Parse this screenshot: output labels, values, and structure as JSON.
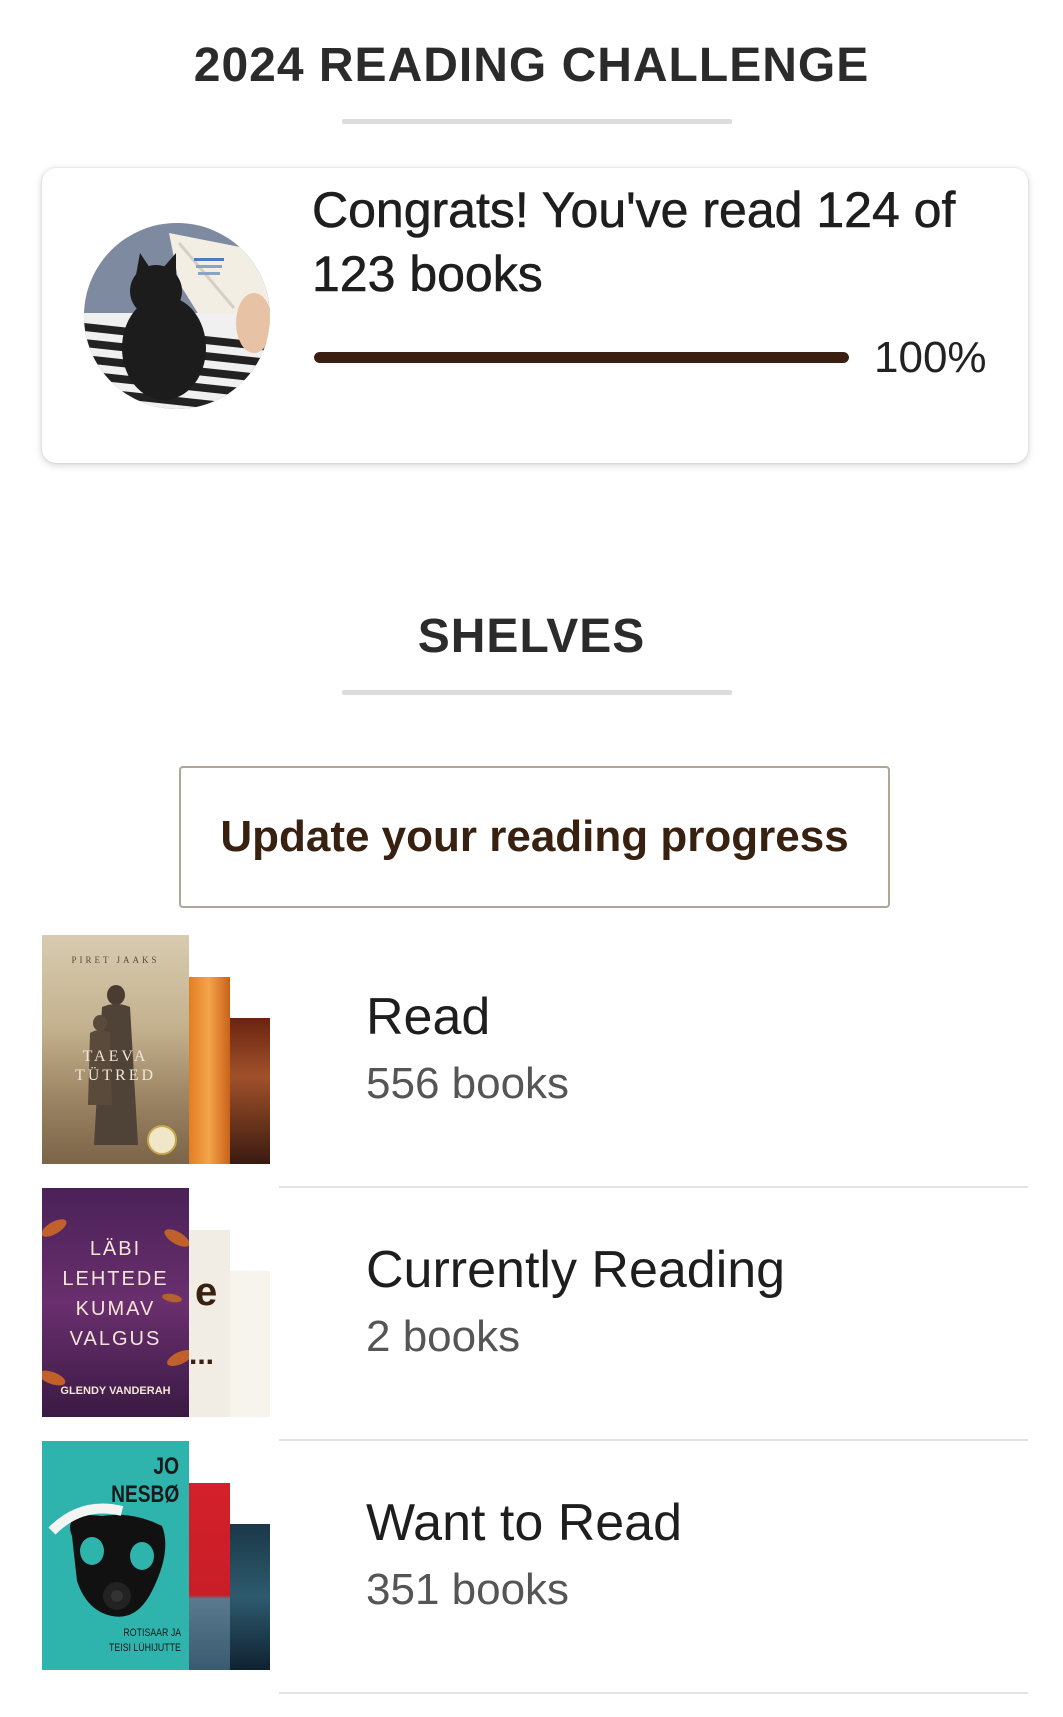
{
  "challenge": {
    "section_title": "2024 READING CHALLENGE",
    "message": "Congrats! You've read 124 of 123 books",
    "progress_fraction": 1.0,
    "progress_label": "100%",
    "avatar_icon": "reader-with-cat-photo"
  },
  "shelves": {
    "section_title": "SHELVES",
    "update_button_label": "Update your reading progress",
    "items": [
      {
        "name": "Read",
        "count": "556 books",
        "front_cover": {
          "author": "PIRET JAAKS",
          "title_line1": "TAEVA",
          "title_line2": "TÜTRED"
        }
      },
      {
        "name": "Currently Reading",
        "count": "2 books",
        "front_cover": {
          "title_line1": "LÄBI",
          "title_line2": "LEHTEDE",
          "title_line3": "KUMAV",
          "title_line4": "VALGUS",
          "author": "GLENDY VANDERAH"
        },
        "second_cover_text": "e",
        "second_cover_ellipsis": "..."
      },
      {
        "name": "Want to Read",
        "count": "351 books",
        "front_cover": {
          "author_line1": "JO",
          "author_line2": "NESBØ",
          "title_line1": "ROTISAAR JA",
          "title_line2": "TEISI LÜHIJUTTE"
        }
      }
    ]
  },
  "colors": {
    "accent_dark_brown": "#382110",
    "progress_fill": "#3a1f12",
    "button_border": "#b0a597"
  }
}
